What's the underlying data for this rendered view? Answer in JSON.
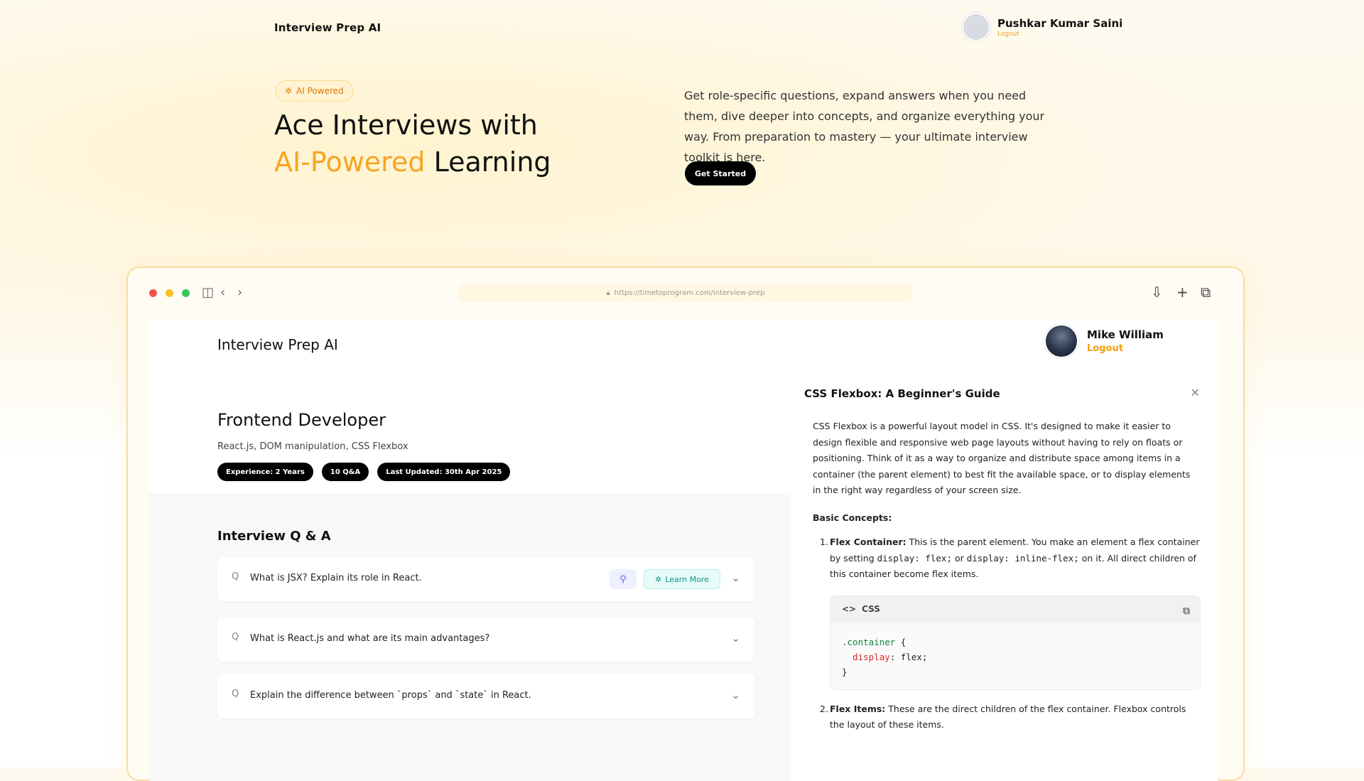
{
  "site": {
    "brand": "Interview Prep AI",
    "user": {
      "name": "Pushkar Kumar Saini",
      "logout": "Logout"
    }
  },
  "hero": {
    "badge": "AI Powered",
    "title_line1": "Ace Interviews with",
    "title_accent": "AI-Powered",
    "title_rest": " Learning",
    "description": "Get role-specific questions, expand answers when you need them, dive deeper into concepts, and organize everything your way. From preparation to mastery — your ultimate interview toolkit is here.",
    "cta": "Get Started",
    "accent_color": "#f5a524"
  },
  "browser": {
    "url": "https://timetoprogram.com/interview-prep",
    "app": {
      "brand": "Interview Prep AI",
      "user": {
        "name": "Mike William",
        "logout": "Logout"
      },
      "role": {
        "title": "Frontend Developer",
        "topics": "React.js, DOM manipulation, CSS Flexbox",
        "pills": [
          "Experience: 2 Years",
          "10 Q&A",
          "Last Updated: 30th Apr 2025"
        ]
      },
      "qa": {
        "title": "Interview Q & A",
        "learn_more": "Learn More",
        "items": [
          "What is JSX? Explain its role in React.",
          "What is React.js and what are its main advantages?",
          "Explain the difference between `props` and `state` in React."
        ]
      },
      "drawer": {
        "title": "CSS Flexbox: A Beginner's Guide",
        "intro": "CSS Flexbox is a powerful layout model in CSS. It's designed to make it easier to design flexible and responsive web page layouts without having to rely on floats or positioning. Think of it as a way to organize and distribute space among items in a container (the parent element) to best fit the available space, or to display elements in the right way regardless of your screen size.",
        "section_heading": "Basic Concepts:",
        "item1": {
          "num": "1.",
          "label": "Flex Container:",
          "text_a": " This is the parent element. You make an element a flex container by setting ",
          "code_a": "display: flex;",
          "text_b": " or ",
          "code_b": "display: inline-flex;",
          "text_c": " on it. All direct children of this container become flex items."
        },
        "code": {
          "lang": "CSS",
          "selector": ".container",
          "open": " {",
          "prop": "display",
          "value": ": flex;",
          "close": "}"
        },
        "item2": {
          "num": "2.",
          "label": "Flex Items:",
          "text": " These are the direct children of the flex container. Flexbox controls the layout of these items."
        }
      }
    }
  }
}
